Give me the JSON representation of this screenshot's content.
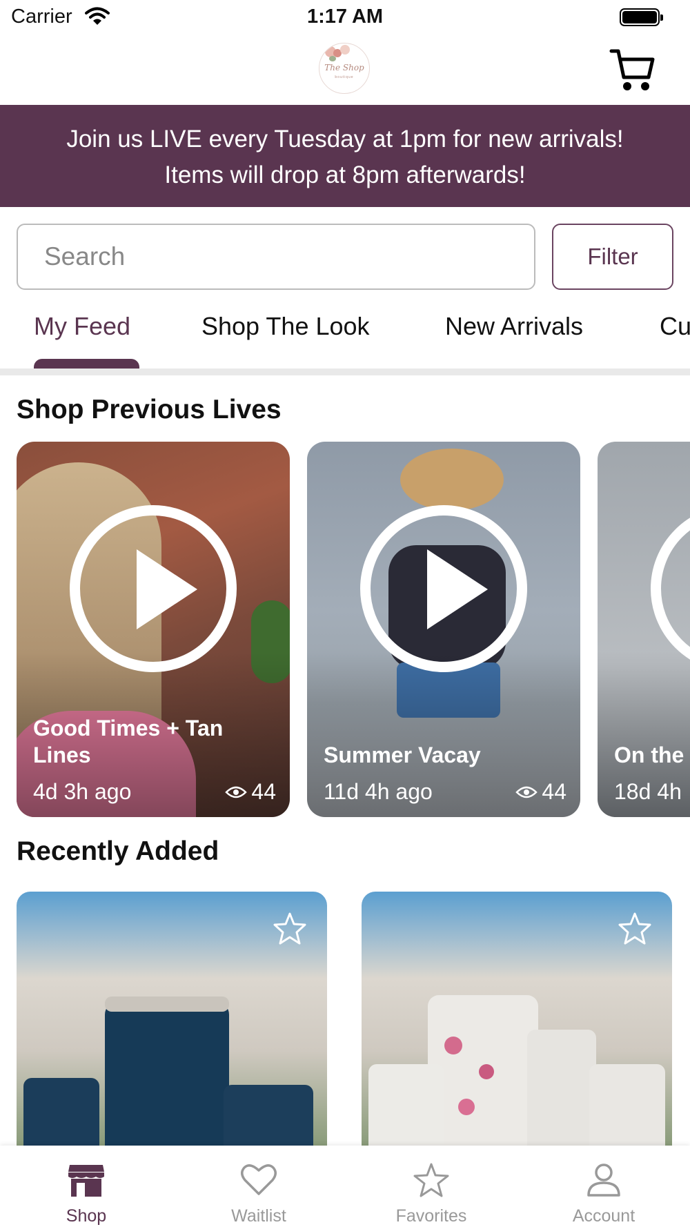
{
  "status_bar": {
    "carrier": "Carrier",
    "time": "1:17 AM"
  },
  "header": {
    "logo_text": "The Shop",
    "logo_subtext": "boutique"
  },
  "promo": {
    "line1": "Join us LIVE every Tuesday at 1pm for new arrivals!",
    "line2": "Items will drop at 8pm afterwards!"
  },
  "search": {
    "placeholder": "Search"
  },
  "filter_label": "Filter",
  "tabs": [
    {
      "label": "My Feed",
      "active": true
    },
    {
      "label": "Shop The Look"
    },
    {
      "label": "New Arrivals"
    },
    {
      "label": "Cu"
    }
  ],
  "sections": {
    "lives_title": "Shop Previous Lives",
    "recent_title": "Recently Added"
  },
  "lives": [
    {
      "title": "Good Times + Tan Lines",
      "ago": "4d 3h ago",
      "views": "44"
    },
    {
      "title": "Summer Vacay",
      "ago": "11d 4h ago",
      "views": "44"
    },
    {
      "title": "On the Summe",
      "ago": "18d 4h"
    }
  ],
  "nav": [
    {
      "label": "Shop",
      "icon": "storefront-icon",
      "active": true
    },
    {
      "label": "Waitlist",
      "icon": "heart-icon"
    },
    {
      "label": "Favorites",
      "icon": "star-icon"
    },
    {
      "label": "Account",
      "icon": "person-icon"
    }
  ],
  "colors": {
    "brand": "#5a3550",
    "inactive": "#999999"
  }
}
